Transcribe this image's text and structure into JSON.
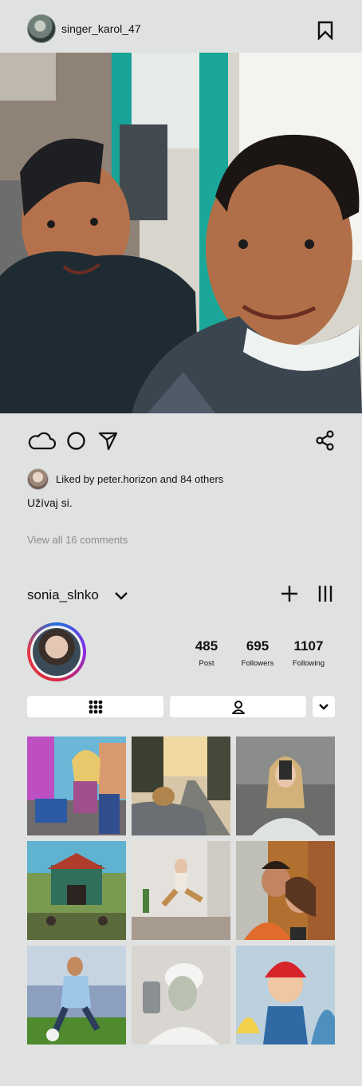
{
  "post": {
    "username": "singer_karol_47",
    "likes_text": "Liked by peter.horizon and 84 others",
    "caption": "Užívaj si.",
    "view_comments": "View all 16 comments"
  },
  "profile": {
    "username": "sonia_slnko",
    "stats": [
      {
        "value": "485",
        "label": "Post"
      },
      {
        "value": "695",
        "label": "Followers"
      },
      {
        "value": "1107",
        "label": "Following"
      }
    ]
  },
  "icons": {
    "bookmark": "bookmark-icon",
    "like": "cloud-icon",
    "comment": "circle-icon",
    "send": "send-icon",
    "share": "share-icon",
    "add": "plus-icon",
    "menu": "menu-icon",
    "grid": "grid-icon",
    "tagged": "person-icon",
    "more": "chevron-down-icon"
  },
  "grid": {
    "tiles": [
      {
        "desc": "animated woman with laptop"
      },
      {
        "desc": "dog in convertible on road"
      },
      {
        "desc": "woman taking mirror selfie"
      },
      {
        "desc": "game temple scene"
      },
      {
        "desc": "woman jumping indoors"
      },
      {
        "desc": "couple selfie in street"
      },
      {
        "desc": "soccer player kicking ball"
      },
      {
        "desc": "woman with face mask selfie"
      },
      {
        "desc": "animated trainer with creatures"
      }
    ]
  }
}
